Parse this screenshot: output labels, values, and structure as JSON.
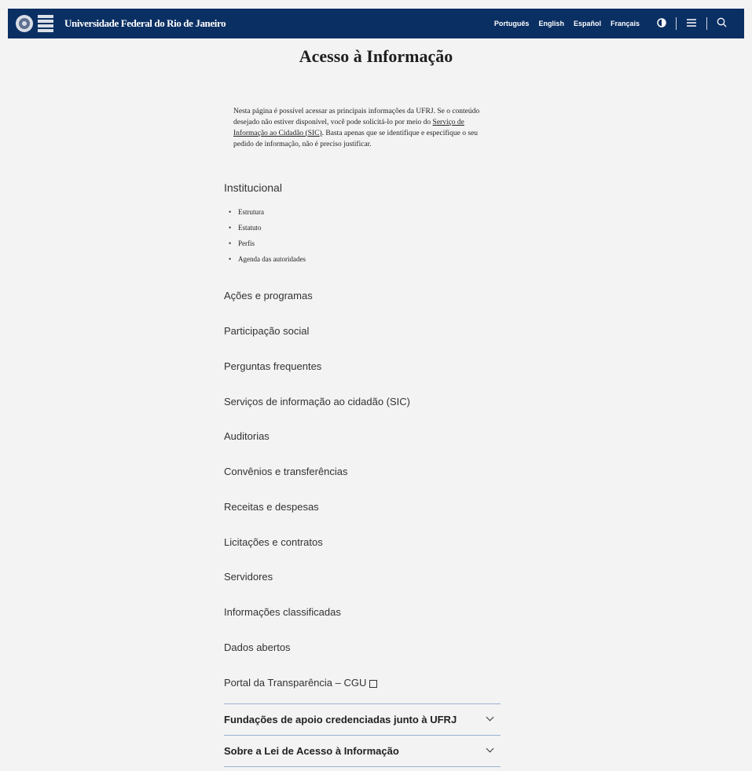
{
  "header": {
    "site_name": "Universidade Federal do Rio de Janeiro",
    "languages": [
      "Português",
      "English",
      "Español",
      "Français"
    ],
    "icons": {
      "contrast": "contrast-icon",
      "menu": "menu-icon",
      "search": "search-icon"
    }
  },
  "page": {
    "title": "Acesso à Informação",
    "intro_before_link": "Nesta página é possível acessar as principais informações da UFRJ. Se o conteúdo desejado não estiver disponível, você pode solicitá-lo por meio do ",
    "intro_link": "Serviço de Informação ao Cidadão (SIC)",
    "intro_after_link": ". Basta apenas que se identifique e especifique o seu pedido de informação, não é preciso justificar."
  },
  "institutional": {
    "title": "Institucional",
    "items": [
      "Estrutura",
      "Estatuto",
      "Perfis",
      "Agenda das autoridades"
    ]
  },
  "sections": [
    "Ações e programas",
    "Participação social",
    "Perguntas frequentes",
    "Serviços de informação ao cidadão (SIC)",
    "Auditorias",
    "Convênios e transferências",
    "Receitas e despesas",
    "Licitações e contratos",
    "Servidores",
    "Informações classificadas",
    "Dados abertos",
    "Portal da Transparência – CGU"
  ],
  "accordion": [
    "Fundações de apoio credenciadas junto à UFRJ",
    "Sobre a Lei de Acesso à Informação"
  ],
  "colors": {
    "header_bg": "#0a2f63",
    "page_bg": "#f3f3f3",
    "divider": "#9bb2d1"
  }
}
